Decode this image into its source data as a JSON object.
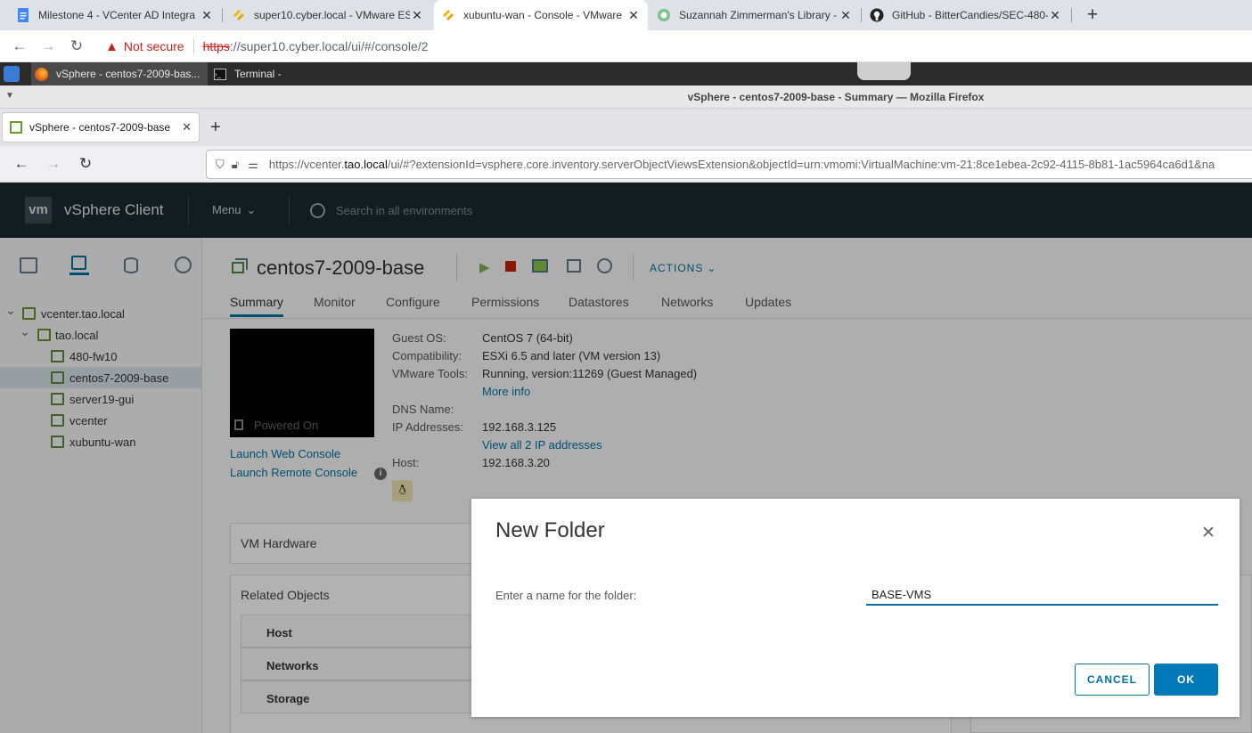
{
  "chrome": {
    "tabs": [
      {
        "title": "Milestone 4 - VCenter AD Integra",
        "close": "✕"
      },
      {
        "title": "super10.cyber.local - VMware ESXi",
        "close": "✕"
      },
      {
        "title": "xubuntu-wan - Console - VMware",
        "close": "✕"
      },
      {
        "title": "Suzannah Zimmerman's Library -",
        "close": "✕"
      },
      {
        "title": "GitHub - BitterCandies/SEC-480-",
        "close": "✕"
      }
    ],
    "new_tab": "+",
    "security_label": "Not secure",
    "url_scheme": "https",
    "url_rest": "://super10.cyber.local/ui/#/console/2"
  },
  "xpanel": {
    "firefox_task": "vSphere - centos7-2009-bas...",
    "terminal_task": "Terminal -"
  },
  "firefox": {
    "window_title": "vSphere - centos7-2009-base - Summary — Mozilla Firefox",
    "tab_title": "vSphere - centos7-2009-base",
    "tab_close": "✕",
    "new_tab": "+",
    "url_prefix": "https://vcenter.",
    "url_host": "tao.local",
    "url_rest": "/ui/#?extensionId=vsphere.core.inventory.serverObjectViewsExtension&objectId=urn:vmomi:VirtualMachine:vm-21:8ce1ebea-2c92-4115-8b81-1ac5964ca6d1&na"
  },
  "vsphere": {
    "logo": "vm",
    "app_name": "vSphere Client",
    "menu": "Menu",
    "search_placeholder": "Search in all environments"
  },
  "tree": [
    {
      "label": "vcenter.tao.local",
      "icon": "vcenter-icon",
      "level": 0,
      "toggle": "⌄"
    },
    {
      "label": "tao.local",
      "icon": "datacenter-icon",
      "level": 1,
      "toggle": "⌄"
    },
    {
      "label": "480-fw10",
      "icon": "vm-icon",
      "level": 2
    },
    {
      "label": "centos7-2009-base",
      "icon": "vm-icon",
      "level": 2,
      "selected": true
    },
    {
      "label": "server19-gui",
      "icon": "vm-icon",
      "level": 2
    },
    {
      "label": "vcenter",
      "icon": "vm-icon",
      "level": 2
    },
    {
      "label": "xubuntu-wan",
      "icon": "vm-icon",
      "level": 2
    }
  ],
  "vm": {
    "name": "centos7-2009-base",
    "actions": "ACTIONS",
    "tabs": [
      "Summary",
      "Monitor",
      "Configure",
      "Permissions",
      "Datastores",
      "Networks",
      "Updates"
    ],
    "active_tab": "Summary",
    "console_status": "Powered On",
    "launch_web": "Launch Web Console",
    "launch_remote": "Launch Remote Console",
    "guest_os_label": "Guest OS:",
    "guest_os": "CentOS 7 (64-bit)",
    "compat_label": "Compatibility:",
    "compat": "ESXi 6.5 and later (VM version 13)",
    "tools_label": "VMware Tools:",
    "tools": "Running, version:11269 (Guest Managed)",
    "more_info": "More info",
    "dns_label": "DNS Name:",
    "ip_label": "IP Addresses:",
    "ip": "192.168.3.125",
    "view_ips": "View all 2 IP addresses",
    "host_label": "Host:",
    "host": "192.168.3.20",
    "hardware_panel": "VM Hardware",
    "related_panel": "Related Objects",
    "related_rows": [
      "Host",
      "Networks",
      "Storage"
    ]
  },
  "dialog": {
    "title": "New Folder",
    "prompt": "Enter a name for the folder:",
    "folder_name": "BASE-VMS",
    "cancel": "CANCEL",
    "ok": "OK",
    "close": "✕"
  },
  "colors": {
    "accent": "#0072a3",
    "header": "#1b2a32",
    "ok_button": "#0079b8"
  }
}
